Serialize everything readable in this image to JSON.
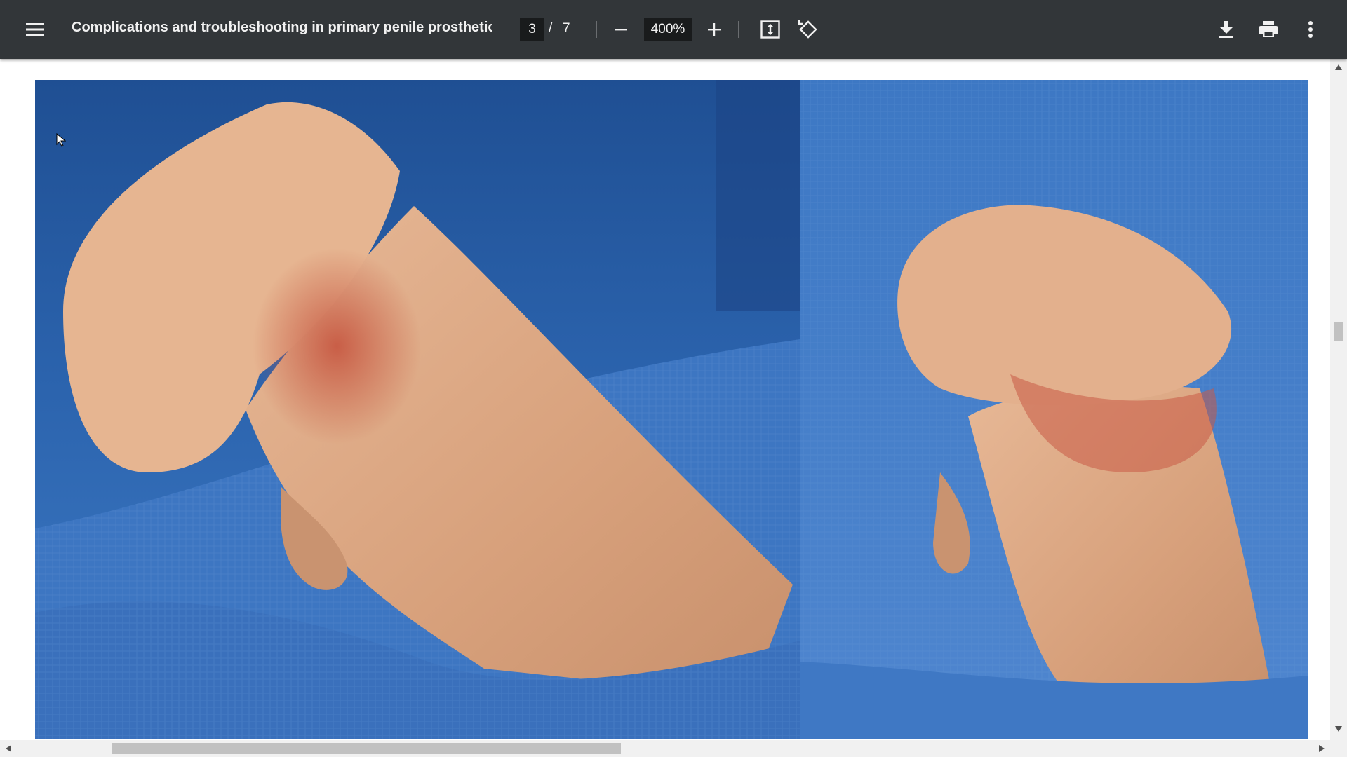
{
  "toolbar": {
    "menu_icon": "hamburger-menu-icon",
    "title": "Complications and troubleshooting in primary penile prosthetic ...",
    "current_page": "3",
    "page_separator": "/",
    "total_pages": "7",
    "zoom_out_icon": "minus-icon",
    "zoom_value": "400%",
    "zoom_in_icon": "plus-icon",
    "fit_page_icon": "fit-to-page-icon",
    "rotate_icon": "rotate-counterclockwise-icon",
    "download_icon": "download-icon",
    "print_icon": "print-icon",
    "more_icon": "more-vertical-icon"
  },
  "colors": {
    "toolbar_bg": "#323639",
    "toolbar_text": "#f1f1f1",
    "input_bg": "#191b1c",
    "drape_blue": "#3b73be",
    "skin_tone": "#d9a07a"
  },
  "document": {
    "content": "clinical photograph (two panels)"
  }
}
